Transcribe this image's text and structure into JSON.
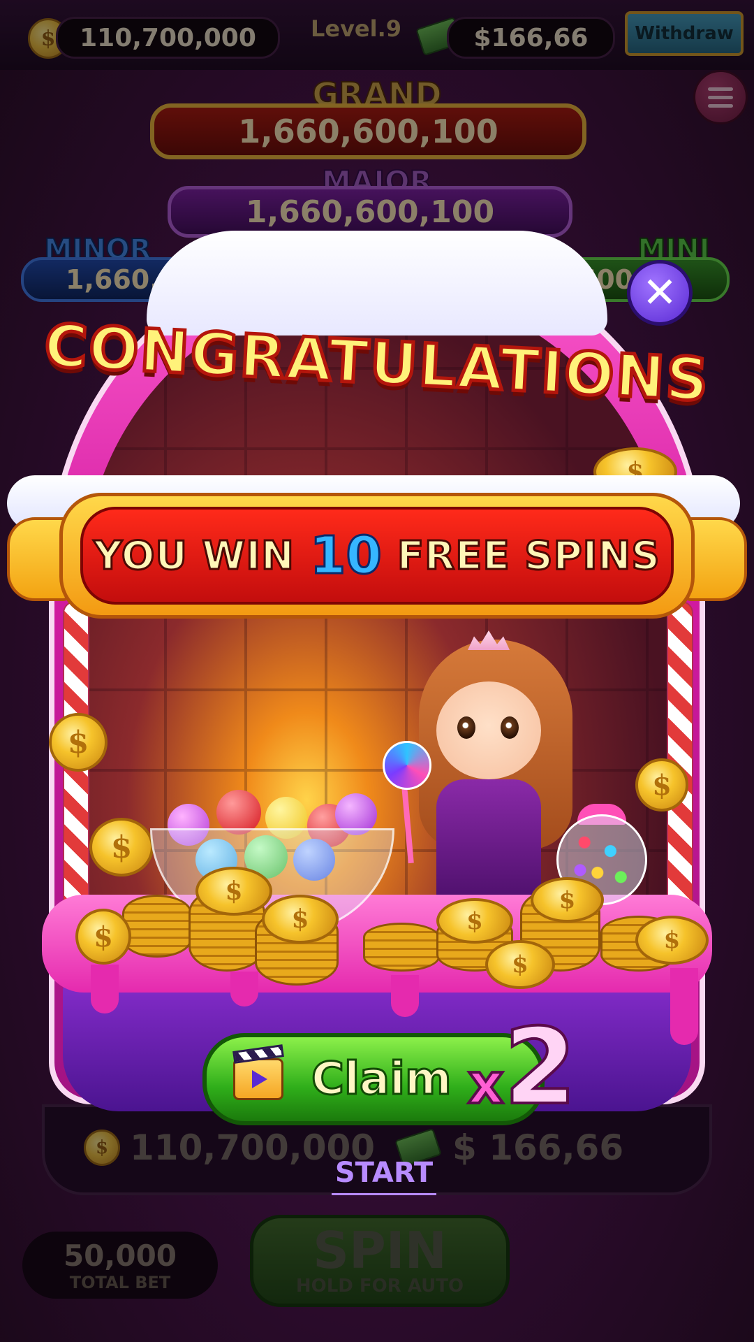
{
  "hud": {
    "coins": "110,700,000",
    "level": "Level.9",
    "cash": "$166,66",
    "withdraw_label": "Withdraw"
  },
  "jackpots": {
    "grand": {
      "title": "GRAND",
      "value": "1,660,600,100"
    },
    "major": {
      "title": "MAJOR",
      "value": "1,660,600,100"
    },
    "minor": {
      "title": "MINOR",
      "value": "1,660,600,10"
    },
    "mini": {
      "title": "MINI",
      "value": "660,600"
    }
  },
  "popup": {
    "title": "CONGRATULATIONS",
    "banner_prefix": "YOU WIN",
    "spin_count": "10",
    "banner_suffix": "FREE SPINS",
    "claim_label": "Claim",
    "multiplier_x": "x",
    "multiplier_value": "2",
    "coin_symbol": "$"
  },
  "bottom": {
    "balance": "110,700,000",
    "cash": "$ 166,66",
    "start_label": "START",
    "total_bet_value": "50,000",
    "total_bet_label": "TOTAL BET",
    "spin_label": "SPIN",
    "spin_sub": "HOLD FOR AUTO"
  },
  "colors": {
    "accent_pink": "#e52aae",
    "claim_green": "#2fae1a",
    "banner_red": "#c30d0d",
    "close_purple": "#5a2ad4"
  }
}
